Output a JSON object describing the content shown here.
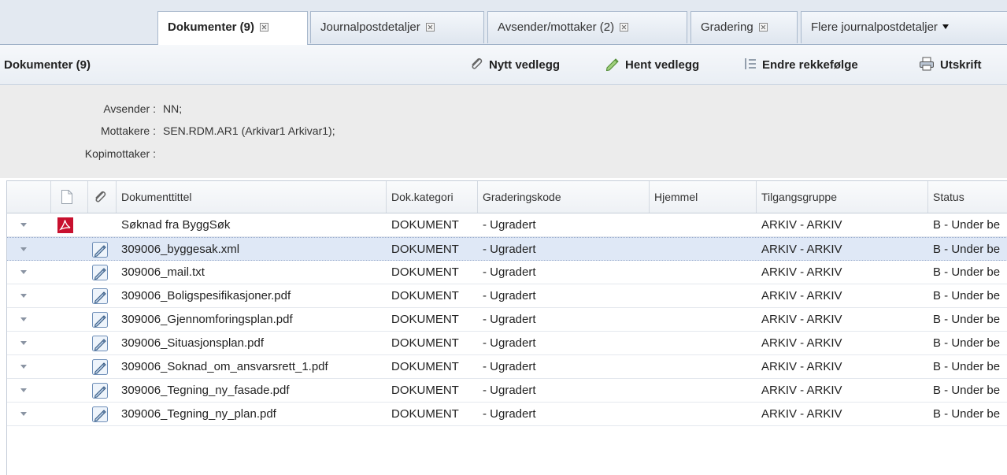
{
  "tabs": [
    {
      "label": "Dokumenter (9)",
      "active": true
    },
    {
      "label": "Journalpostdetaljer"
    },
    {
      "label": "Avsender/mottaker (2)"
    },
    {
      "label": "Gradering"
    },
    {
      "label": "Flere journalpostdetaljer"
    }
  ],
  "toolbar": {
    "title": "Dokumenter (9)",
    "buttons": {
      "nytt_vedlegg": "Nytt vedlegg",
      "hent_vedlegg": "Hent vedlegg",
      "endre_rekkefolge": "Endre rekkefølge",
      "utskrift": "Utskrift"
    }
  },
  "info": {
    "avsender_label": "Avsender :",
    "avsender_value": "NN;",
    "mottakere_label": "Mottakere :",
    "mottakere_value": "SEN.RDM.AR1 (Arkivar1 Arkivar1);",
    "kopimottaker_label": "Kopimottaker :",
    "kopimottaker_value": ""
  },
  "grid": {
    "columns": {
      "dokumenttittel": "Dokumenttittel",
      "dokkategori": "Dok.kategori",
      "graderingskode": "Graderingskode",
      "hjemmel": "Hjemmel",
      "tilgangsgruppe": "Tilgangsgruppe",
      "status": "Status"
    },
    "rows": [
      {
        "title": "Søknad fra ByggSøk",
        "kategori": "DOKUMENT",
        "gradering": "- Ugradert",
        "hjemmel": "",
        "tilgang": "ARKIV - ARKIV",
        "status": "B - Under be",
        "icon": "pdf-icon",
        "selected": false
      },
      {
        "title": "309006_byggesak.xml",
        "kategori": "DOKUMENT",
        "gradering": "- Ugradert",
        "hjemmel": "",
        "tilgang": "ARKIV - ARKIV",
        "status": "B - Under be",
        "icon": "attachment-icon",
        "selected": true
      },
      {
        "title": "309006_mail.txt",
        "kategori": "DOKUMENT",
        "gradering": "- Ugradert",
        "hjemmel": "",
        "tilgang": "ARKIV - ARKIV",
        "status": "B - Under be",
        "icon": "attachment-icon",
        "selected": false
      },
      {
        "title": "309006_Boligspesifikasjoner.pdf",
        "kategori": "DOKUMENT",
        "gradering": "- Ugradert",
        "hjemmel": "",
        "tilgang": "ARKIV - ARKIV",
        "status": "B - Under be",
        "icon": "attachment-icon",
        "selected": false
      },
      {
        "title": "309006_Gjennomforingsplan.pdf",
        "kategori": "DOKUMENT",
        "gradering": "- Ugradert",
        "hjemmel": "",
        "tilgang": "ARKIV - ARKIV",
        "status": "B - Under be",
        "icon": "attachment-icon",
        "selected": false
      },
      {
        "title": "309006_Situasjonsplan.pdf",
        "kategori": "DOKUMENT",
        "gradering": "- Ugradert",
        "hjemmel": "",
        "tilgang": "ARKIV - ARKIV",
        "status": "B - Under be",
        "icon": "attachment-icon",
        "selected": false
      },
      {
        "title": "309006_Soknad_om_ansvarsrett_1.pdf",
        "kategori": "DOKUMENT",
        "gradering": "- Ugradert",
        "hjemmel": "",
        "tilgang": "ARKIV - ARKIV",
        "status": "B - Under be",
        "icon": "attachment-icon",
        "selected": false
      },
      {
        "title": "309006_Tegning_ny_fasade.pdf",
        "kategori": "DOKUMENT",
        "gradering": "- Ugradert",
        "hjemmel": "",
        "tilgang": "ARKIV - ARKIV",
        "status": "B - Under be",
        "icon": "attachment-icon",
        "selected": false
      },
      {
        "title": "309006_Tegning_ny_plan.pdf",
        "kategori": "DOKUMENT",
        "gradering": "- Ugradert",
        "hjemmel": "",
        "tilgang": "ARKIV - ARKIV",
        "status": "B - Under be",
        "icon": "attachment-icon",
        "selected": false
      }
    ]
  },
  "colors": {
    "tabstrip_bg": "#e3e9f1",
    "selected_row_bg": "#dfe8f6",
    "info_bg": "#ececec",
    "pdf_red": "#c8102e"
  }
}
